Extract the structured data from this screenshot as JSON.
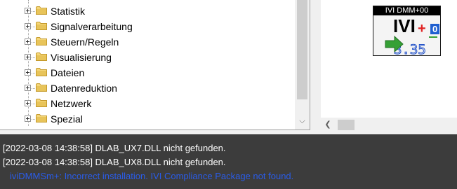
{
  "tree": {
    "items": [
      {
        "label": "Statistik"
      },
      {
        "label": "Signalverarbeitung"
      },
      {
        "label": "Steuern/Regeln"
      },
      {
        "label": "Visualisierung"
      },
      {
        "label": "Dateien"
      },
      {
        "label": "Datenreduktion"
      },
      {
        "label": "Netzwerk"
      },
      {
        "label": "Spezial"
      }
    ],
    "folder_icon": "folder-icon",
    "folder_color": "#e8c45a"
  },
  "module_block": {
    "title": "IVI DMM+00",
    "icon_text": "IVI",
    "badge": "0",
    "display_value": "3.35",
    "colors": {
      "plus": "#e02020",
      "badge": "#1f5fd0",
      "arrow": "#35a035",
      "display": "#2050c8"
    }
  },
  "log": {
    "lines": [
      {
        "text": "[2022-03-08 14:38:58] DLAB_UX7.DLL nicht gefunden.",
        "color": "#ffffff"
      },
      {
        "text": "[2022-03-08 14:38:58] DLAB_UX8.DLL nicht gefunden.",
        "color": "#ffffff"
      },
      {
        "text": "iviDMMSm+: Incorrect installation. IVI Compliance Package not found.",
        "color": "#2a5ce8"
      }
    ]
  }
}
